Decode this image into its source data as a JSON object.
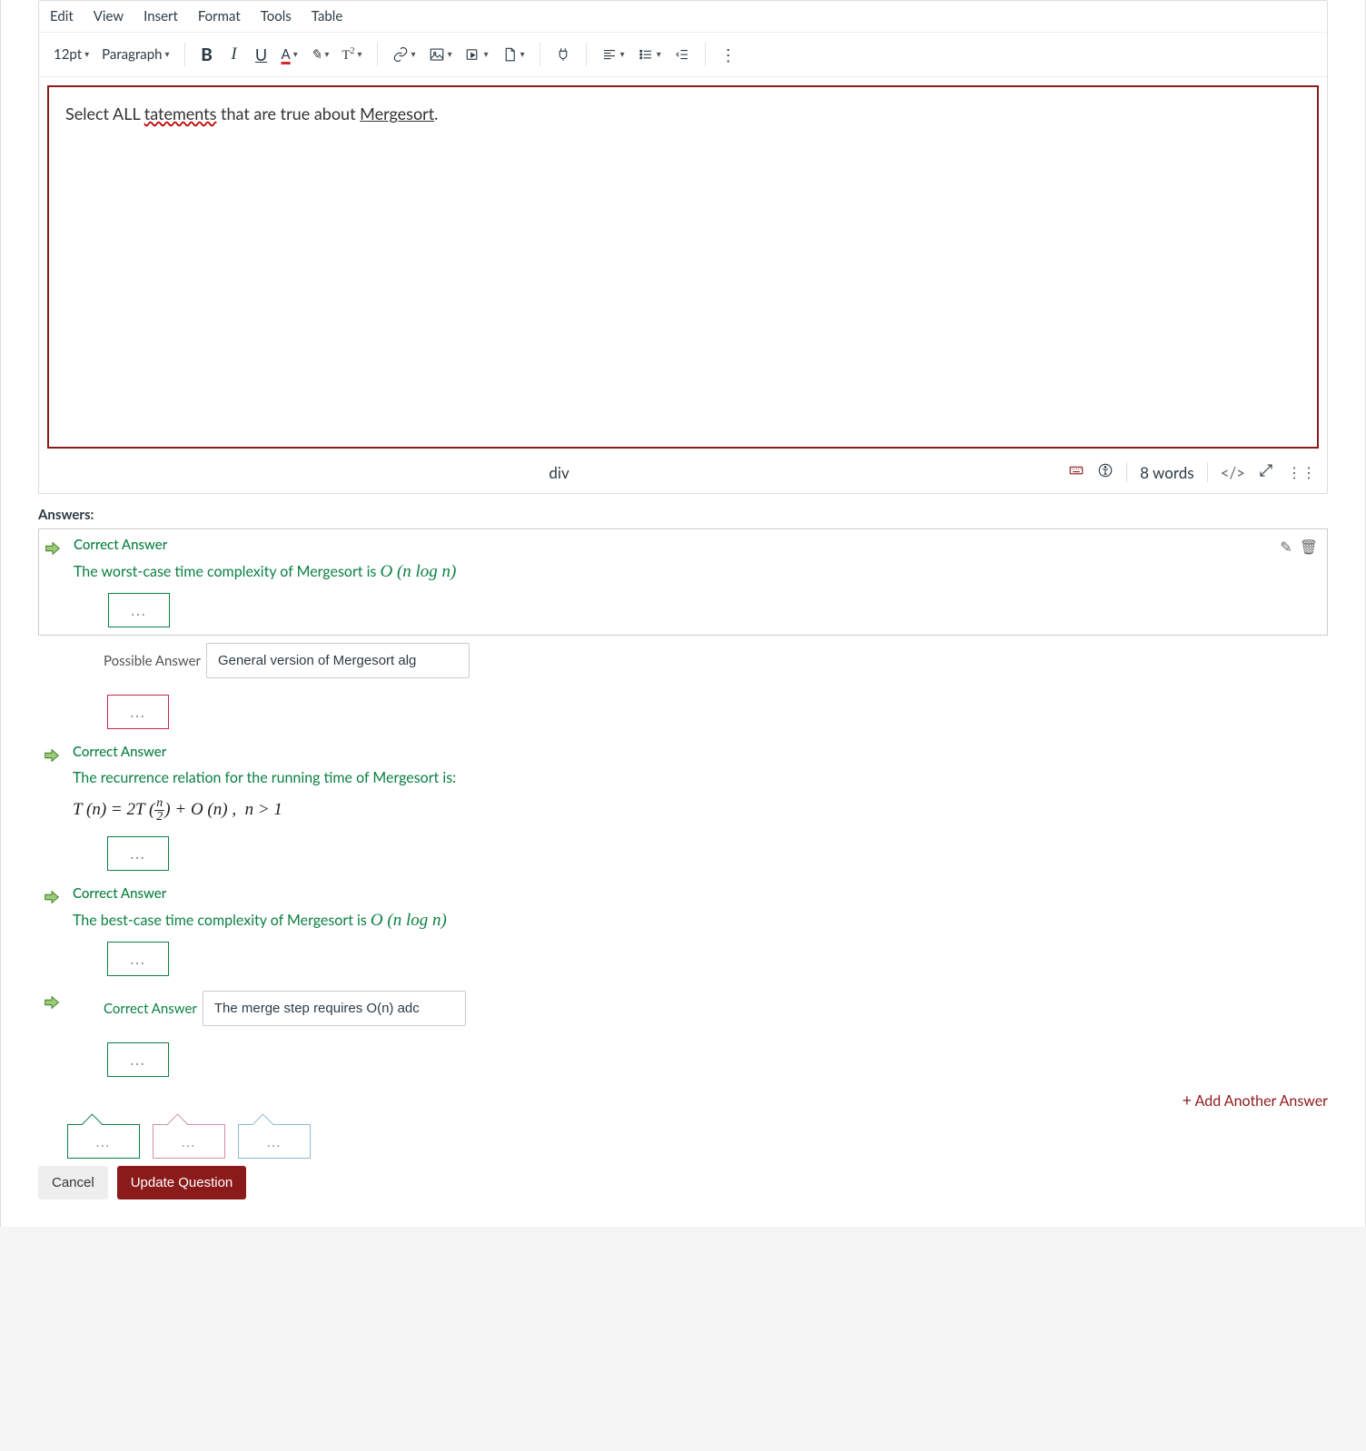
{
  "menubar": [
    "Edit",
    "View",
    "Insert",
    "Format",
    "Tools",
    "Table"
  ],
  "toolbar": {
    "font_size": "12pt",
    "block": "Paragraph"
  },
  "editor_content": {
    "pre": "Select ALL ",
    "err": "tatements",
    "mid": " that are true about ",
    "term": "Mergesort",
    "post": "."
  },
  "status": {
    "path": "div",
    "words": "8 words",
    "code": "</>"
  },
  "answers_label": "Answers:",
  "answers": [
    {
      "kind": "correct",
      "label": "Correct Answer",
      "text_pre": "The worst-case time complexity of Mergesort is ",
      "math": "O (n log n)",
      "comment_color": "green",
      "show_actions": true
    },
    {
      "kind": "possible",
      "label": "Possible Answer",
      "input_value": "General version of Mergesort alg",
      "comment_color": "red"
    },
    {
      "kind": "correct",
      "label": "Correct Answer",
      "text_pre": "The recurrence relation for the running time of Mergesort is:",
      "math_line": "T (n) = 2T (n/2) + O (n) ,  n > 1",
      "comment_color": "green"
    },
    {
      "kind": "correct",
      "label": "Correct Answer",
      "text_pre": "The best-case time complexity of Mergesort is ",
      "math": "O (n log n)",
      "comment_color": "green"
    },
    {
      "kind": "correct-inline",
      "label": "Correct Answer",
      "input_value": "The merge step requires O(n) adc",
      "comment_color": "green"
    }
  ],
  "add_another": "Add Another Answer",
  "buttons": {
    "cancel": "Cancel",
    "update": "Update Question"
  },
  "ellipsis": "..."
}
